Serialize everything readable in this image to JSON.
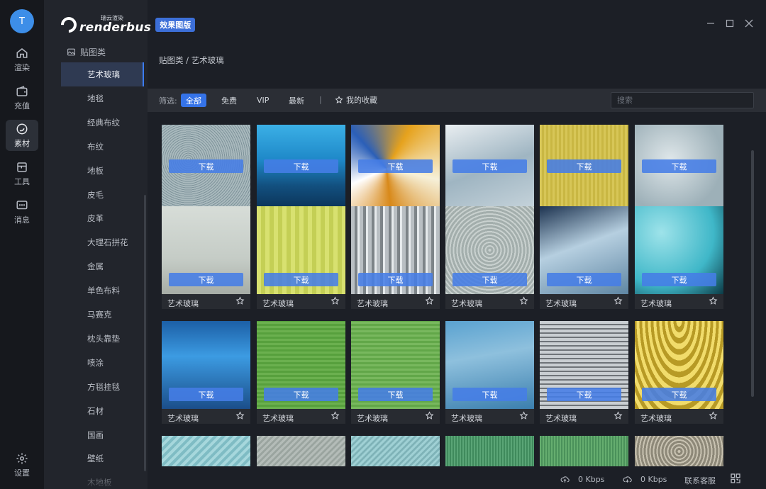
{
  "app": {
    "logo_small": "瑞云渲染",
    "logo_brand": "renderbus",
    "logo_badge": "效果图版",
    "avatar_letter": "T"
  },
  "rail": [
    {
      "label": "渲染",
      "icon": "home-icon"
    },
    {
      "label": "充值",
      "icon": "wallet-icon"
    },
    {
      "label": "素材",
      "icon": "material-icon",
      "active": true
    },
    {
      "label": "工具",
      "icon": "tools-icon"
    },
    {
      "label": "消息",
      "icon": "message-icon"
    },
    {
      "label": "设置",
      "icon": "gear-icon"
    }
  ],
  "categories": {
    "group_label": "贴图类",
    "items": [
      "艺术玻璃",
      "地毯",
      "经典布纹",
      "布纹",
      "地板",
      "皮毛",
      "皮革",
      "大理石拼花",
      "金属",
      "单色布料",
      "马赛克",
      "枕头靠垫",
      "喷涂",
      "方毯挂毯",
      "石材",
      "国画",
      "壁纸",
      "木地板"
    ],
    "active": "艺术玻璃"
  },
  "breadcrumb": "贴图类 / 艺术玻璃",
  "filter": {
    "label": "筛选:",
    "buttons": [
      "全部",
      "免费",
      "VIP",
      "最新"
    ],
    "active": "全部",
    "separator": "|",
    "favorites": "我的收藏",
    "search_placeholder": "搜索"
  },
  "grid": {
    "download_label": "下载",
    "item_label": "艺术玻璃",
    "rows": 3,
    "cols": 6
  },
  "status": {
    "upload_speed": "0 Kbps",
    "download_speed": "0 Kbps",
    "support": "联系客服"
  },
  "colors": {
    "accent": "#3573e8",
    "background": "#1c1f26"
  }
}
